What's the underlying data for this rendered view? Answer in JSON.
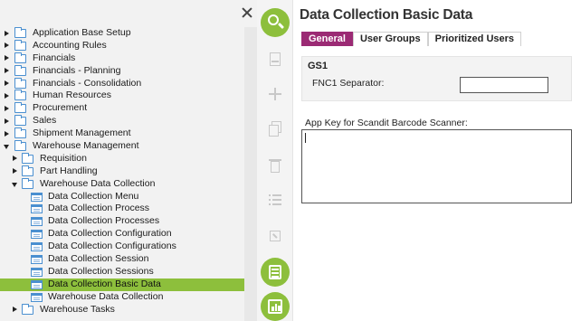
{
  "navigation": {
    "items": [
      {
        "label": "Application Base Setup",
        "expander": "collapsed",
        "icon": "folder-icon",
        "indent": 0
      },
      {
        "label": "Accounting Rules",
        "expander": "collapsed",
        "icon": "folder-icon",
        "indent": 0
      },
      {
        "label": "Financials",
        "expander": "collapsed",
        "icon": "folder-icon",
        "indent": 0
      },
      {
        "label": "Financials - Planning",
        "expander": "collapsed",
        "icon": "folder-icon",
        "indent": 0
      },
      {
        "label": "Financials - Consolidation",
        "expander": "collapsed",
        "icon": "folder-icon",
        "indent": 0
      },
      {
        "label": "Human Resources",
        "expander": "collapsed",
        "icon": "folder-icon",
        "indent": 0
      },
      {
        "label": "Procurement",
        "expander": "collapsed",
        "icon": "folder-icon",
        "indent": 0
      },
      {
        "label": "Sales",
        "expander": "collapsed",
        "icon": "folder-icon",
        "indent": 0
      },
      {
        "label": "Shipment Management",
        "expander": "collapsed",
        "icon": "folder-icon",
        "indent": 0
      },
      {
        "label": "Warehouse Management",
        "expander": "expanded",
        "icon": "folder-icon",
        "indent": 0
      },
      {
        "label": "Requisition",
        "expander": "collapsed",
        "icon": "folder-icon",
        "indent": 1
      },
      {
        "label": "Part Handling",
        "expander": "collapsed",
        "icon": "folder-icon",
        "indent": 1
      },
      {
        "label": "Warehouse Data Collection",
        "expander": "expanded",
        "icon": "folder-icon",
        "indent": 1
      },
      {
        "label": "Data Collection Menu",
        "expander": "none",
        "icon": "form-icon",
        "indent": 2
      },
      {
        "label": "Data Collection Process",
        "expander": "none",
        "icon": "form-icon",
        "indent": 2
      },
      {
        "label": "Data Collection Processes",
        "expander": "none",
        "icon": "form-icon",
        "indent": 2
      },
      {
        "label": "Data Collection Configuration",
        "expander": "none",
        "icon": "form-icon",
        "indent": 2
      },
      {
        "label": "Data Collection Configurations",
        "expander": "none",
        "icon": "form-icon",
        "indent": 2
      },
      {
        "label": "Data Collection Session",
        "expander": "none",
        "icon": "form-icon",
        "indent": 2
      },
      {
        "label": "Data Collection Sessions",
        "expander": "none",
        "icon": "form-icon",
        "indent": 2
      },
      {
        "label": "Data Collection Basic Data",
        "expander": "none",
        "icon": "form-icon",
        "indent": 2,
        "selected": true
      },
      {
        "label": "Warehouse Data Collection",
        "expander": "none",
        "icon": "form-icon",
        "indent": 2
      },
      {
        "label": "Warehouse Tasks",
        "expander": "collapsed",
        "icon": "folder-icon",
        "indent": 1
      }
    ]
  },
  "toolbar": {
    "buttons": [
      {
        "name": "search-button",
        "icon": "search-icon",
        "active": true
      },
      {
        "name": "save-button",
        "icon": "save-icon",
        "active": false
      },
      {
        "name": "add-button",
        "icon": "plus-icon",
        "active": false
      },
      {
        "name": "duplicate-button",
        "icon": "duplicate-icon",
        "active": false
      },
      {
        "name": "delete-button",
        "icon": "trash-icon",
        "active": false
      },
      {
        "name": "list-view-button",
        "icon": "list-icon",
        "active": false
      },
      {
        "name": "navigate-button",
        "icon": "link-out-icon",
        "active": false
      },
      {
        "name": "details-button",
        "icon": "details-list-icon",
        "active": true
      },
      {
        "name": "analytics-button",
        "icon": "bar-chart-icon",
        "active": true
      }
    ]
  },
  "page": {
    "title": "Data Collection Basic Data",
    "tabs": [
      {
        "label": "General",
        "active": true
      },
      {
        "label": "User Groups",
        "active": false
      },
      {
        "label": "Prioritized Users",
        "active": false
      }
    ],
    "gs1_group": {
      "title": "GS1",
      "fnc1_label": "FNC1 Separator:",
      "fnc1_value": ""
    },
    "app_key": {
      "label": "App Key for Scandit Barcode Scanner:",
      "value": ""
    }
  },
  "colors": {
    "accent_green": "#8dbf3c",
    "tab_active": "#9b2a74",
    "folder_blue": "#4a8fd0"
  }
}
